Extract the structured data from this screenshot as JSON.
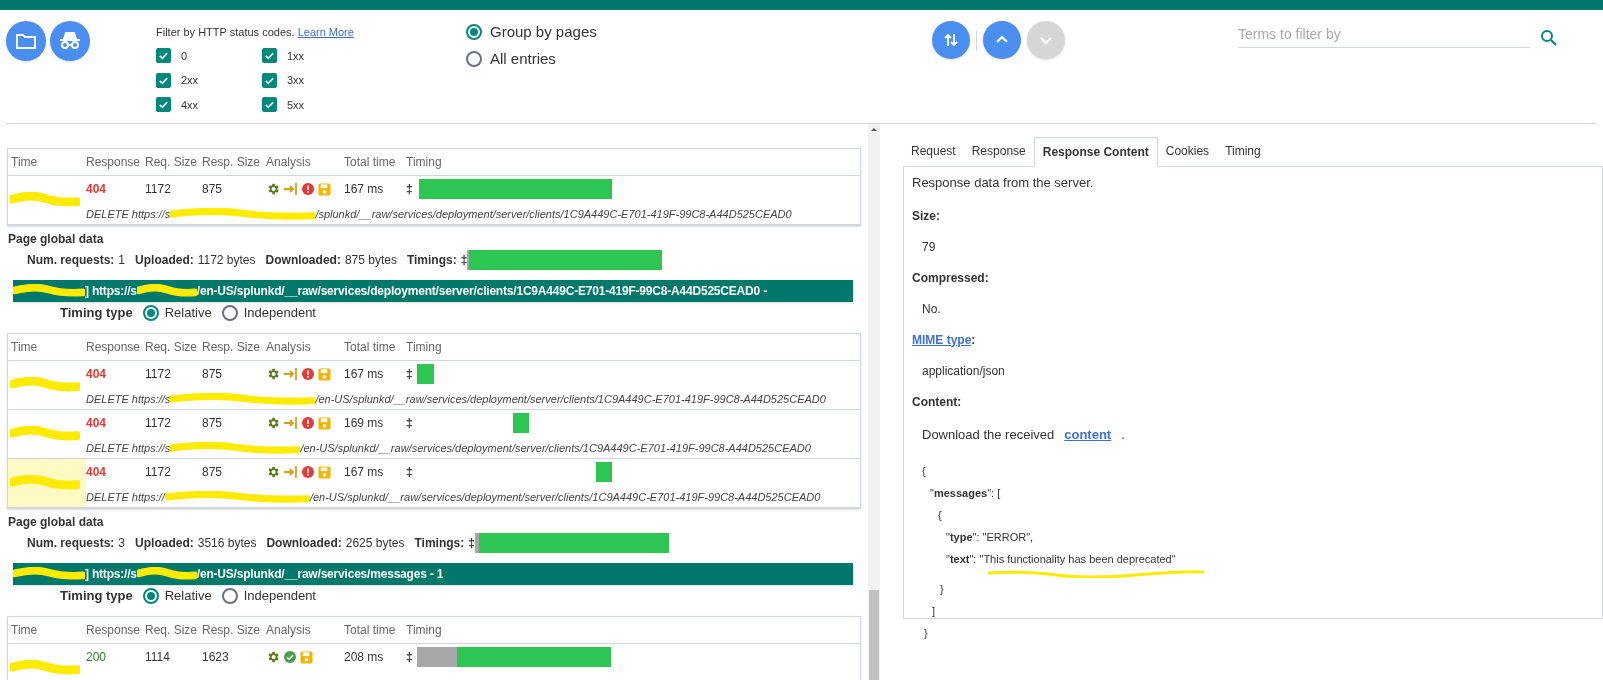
{
  "toolbar": {
    "buttons": [
      {
        "kind": "folder"
      },
      {
        "kind": "incognito"
      }
    ],
    "filter": {
      "label": "Filter by HTTP status codes.",
      "link": "Learn More",
      "codes": [
        {
          "label": "0",
          "checked": true
        },
        {
          "label": "1xx",
          "checked": true
        },
        {
          "label": "2xx",
          "checked": true
        },
        {
          "label": "3xx",
          "checked": true
        },
        {
          "label": "4xx",
          "checked": true
        },
        {
          "label": "5xx",
          "checked": true
        }
      ]
    },
    "grouping": [
      {
        "label": "Group by pages",
        "selected": true
      },
      {
        "label": "All entries",
        "selected": false
      }
    ],
    "nav": [
      {
        "kind": "sort",
        "disabled": false
      },
      {
        "kind": "up",
        "disabled": false
      },
      {
        "kind": "down",
        "disabled": true
      }
    ],
    "search": {
      "placeholder": "Terms to filter by"
    }
  },
  "pages": [
    {
      "table": {
        "columns": [
          "Time",
          "Response",
          "Req. Size",
          "Resp. Size",
          "Analysis",
          "Total time",
          "Timing"
        ],
        "rows": [
          {
            "highlighted": false,
            "response": "404",
            "kind": "error",
            "req_size": "1172",
            "resp_size": "875",
            "analysis": [
              {
                "kind": "gear"
              },
              {
                "kind": "redirect"
              },
              {
                "kind": "error"
              },
              {
                "kind": "save"
              }
            ],
            "total_time": "167 ms",
            "marker": "‡",
            "url_start": "DELETE https://s",
            "url_end": "/splunkd/__raw/services/deployment/server/clients/1C9A449C-E701-419F-99C8-A44D525CEAD0"
          }
        ]
      },
      "global": {
        "title": "Page global data",
        "stats": [
          {
            "label": "Num. requests:",
            "value": "1"
          },
          {
            "label": "Uploaded:",
            "value": "1172 bytes"
          },
          {
            "label": "Downloaded:",
            "value": "875 bytes"
          }
        ],
        "timings_label": "Timings:",
        "marker": "‡"
      }
    },
    {
      "header": {
        "start": "] https://s",
        "end": "/en-US/splunkd/__raw/services/deployment/server/clients/1C9A449C-E701-419F-99C8-A44D525CEAD0 -"
      },
      "timing_type": {
        "label": "Timing type",
        "options": [
          {
            "label": "Relative",
            "selected": true
          },
          {
            "label": "Independent",
            "selected": false
          }
        ]
      },
      "table": {
        "columns": [
          "Time",
          "Response",
          "Req. Size",
          "Resp. Size",
          "Analysis",
          "Total time",
          "Timing"
        ],
        "rows": [
          {
            "highlighted": false,
            "response": "404",
            "kind": "error",
            "req_size": "1172",
            "resp_size": "875",
            "analysis": [
              {
                "kind": "gear"
              },
              {
                "kind": "redirect"
              },
              {
                "kind": "error"
              },
              {
                "kind": "save"
              }
            ],
            "total_time": "167 ms",
            "marker": "‡",
            "url_start": "DELETE https://s",
            "url_end": "/en-US/splunkd/__raw/services/deployment/server/clients/1C9A449C-E701-419F-99C8-A44D525CEAD0"
          },
          {
            "highlighted": false,
            "response": "404",
            "kind": "error",
            "req_size": "1172",
            "resp_size": "875",
            "analysis": [
              {
                "kind": "gear"
              },
              {
                "kind": "redirect"
              },
              {
                "kind": "error"
              },
              {
                "kind": "save"
              }
            ],
            "total_time": "169 ms",
            "marker": "‡",
            "url_start": "DELETE https://s",
            "url_end": "/en-US/splunkd/__raw/services/deployment/server/clients/1C9A449C-E701-419F-99C8-A44D525CEAD0"
          },
          {
            "highlighted": true,
            "response": "404",
            "kind": "error",
            "req_size": "1172",
            "resp_size": "875",
            "analysis": [
              {
                "kind": "gear"
              },
              {
                "kind": "redirect"
              },
              {
                "kind": "error"
              },
              {
                "kind": "save"
              }
            ],
            "total_time": "167 ms",
            "marker": "‡",
            "url_start": "DELETE https://",
            "url_end": "/en-US/splunkd/__raw/services/deployment/server/clients/1C9A449C-E701-419F-99C8-A44D525CEAD0"
          }
        ]
      },
      "global": {
        "title": "Page global data",
        "stats": [
          {
            "label": "Num. requests:",
            "value": "3"
          },
          {
            "label": "Uploaded:",
            "value": "3516 bytes"
          },
          {
            "label": "Downloaded:",
            "value": "2625 bytes"
          }
        ],
        "timings_label": "Timings:",
        "marker": "‡"
      }
    },
    {
      "header": {
        "start": "] https://s",
        "end": "/en-US/splunkd/__raw/services/messages - 1"
      },
      "timing_type": {
        "label": "Timing type",
        "options": [
          {
            "label": "Relative",
            "selected": true
          },
          {
            "label": "Independent",
            "selected": false
          }
        ]
      },
      "table": {
        "columns": [
          "Time",
          "Response",
          "Req. Size",
          "Resp. Size",
          "Analysis",
          "Total time",
          "Timing"
        ],
        "rows": [
          {
            "highlighted": false,
            "response": "200",
            "kind": "ok",
            "req_size": "1114",
            "resp_size": "1623",
            "analysis": [
              {
                "kind": "gear"
              },
              {
                "kind": "ok"
              },
              {
                "kind": "save"
              }
            ],
            "total_time": "208 ms",
            "marker": "‡"
          }
        ]
      }
    }
  ],
  "details": {
    "tabs": [
      {
        "label": "Request",
        "selected": false
      },
      {
        "label": "Response",
        "selected": false
      },
      {
        "label": "Response Content",
        "selected": true
      },
      {
        "label": "Cookies",
        "selected": false
      },
      {
        "label": "Timing",
        "selected": false
      }
    ],
    "intro": "Response data from the server.",
    "fields": [
      {
        "label": "Size:",
        "value": "79"
      },
      {
        "label": "Compressed:",
        "value": "No."
      },
      {
        "label": "MIME type",
        "link": true,
        "suffix": ":",
        "value": "application/json"
      }
    ],
    "content_label": "Content:",
    "download": {
      "before": "Download the received",
      "link": "content",
      "after": "."
    },
    "json": {
      "open": "{",
      "close": "}",
      "children": [
        {
          "open": "\"**messages**\": [",
          "close": "]",
          "children": [
            {
              "open": "{",
              "close": "}",
              "children": [
                {
                  "text": "\"**type**\": \"ERROR\","
                },
                {
                  "text": "\"**text**\": \"This functionality has been deprecated\"",
                  "underlined": true
                }
              ]
            }
          ]
        }
      ]
    }
  }
}
